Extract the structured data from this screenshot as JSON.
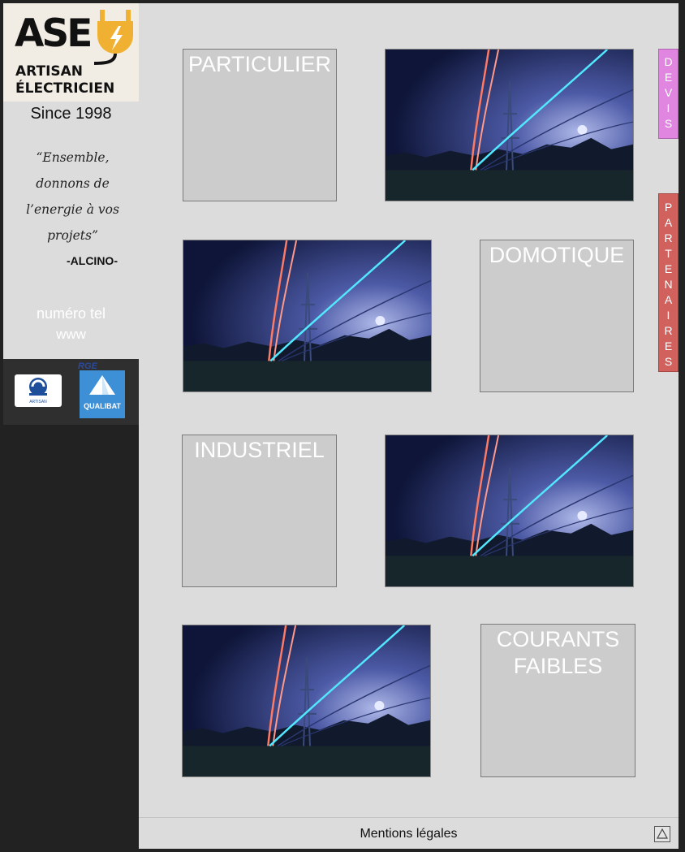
{
  "brand": {
    "logo_text": "ASE",
    "logo_line1": "ARTISAN",
    "logo_line2": "ÉLECTRICIEN",
    "since": "Since 1998",
    "quote": "“Ensemble, donnons de l’energie à vos projets”",
    "author": "-ALCINO-",
    "phone": "numéro tel",
    "web": "www"
  },
  "certifications": {
    "artisan": "ARTISAN",
    "rge": "RGE",
    "qualibat": "QUALIBAT"
  },
  "sections": [
    {
      "title": "PARTICULIER"
    },
    {
      "title": "DOMOTIQUE"
    },
    {
      "title": "INDUSTRIEL"
    },
    {
      "title": "COURANTS FAIBLES"
    }
  ],
  "side_tabs": {
    "devis": [
      "D",
      "E",
      "V",
      "I",
      "S"
    ],
    "partenaires": [
      "P",
      "A",
      "R",
      "T",
      "E",
      "N",
      "A",
      "I",
      "R",
      "E",
      "S"
    ]
  },
  "footer": {
    "mentions": "Mentions légales"
  },
  "icons": {
    "plug": "plug-icon",
    "scroll_top": "triangle-up-icon"
  },
  "colors": {
    "devis": "#e085e0",
    "partenaires": "#d0615c",
    "logo_plug": "#f0b132"
  }
}
